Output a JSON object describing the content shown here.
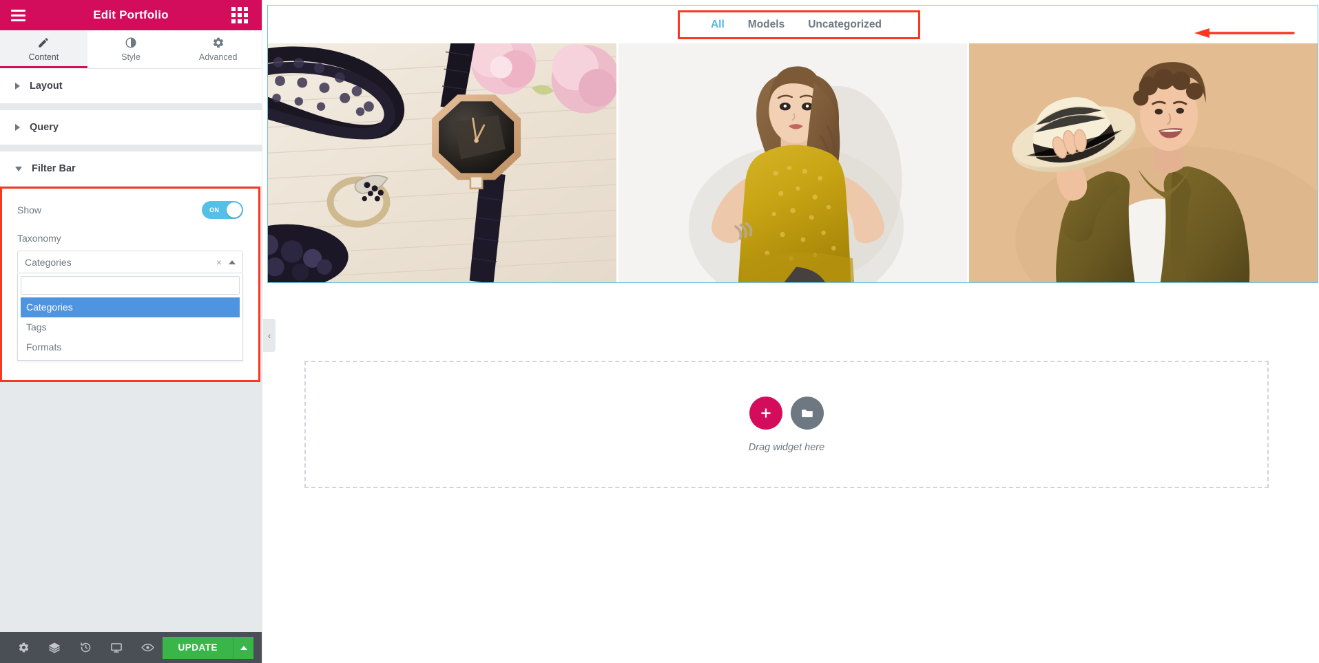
{
  "panel": {
    "header": {
      "title": "Edit Portfolio",
      "menu_icon": "hamburger-icon",
      "apps_icon": "apps-grid-icon"
    },
    "tabs": [
      {
        "label": "Content",
        "icon": "pencil-icon",
        "active": true
      },
      {
        "label": "Style",
        "icon": "contrast-icon",
        "active": false
      },
      {
        "label": "Advanced",
        "icon": "gear-icon",
        "active": false
      }
    ],
    "sections": [
      {
        "label": "Layout",
        "open": false
      },
      {
        "label": "Query",
        "open": false
      },
      {
        "label": "Filter Bar",
        "open": true
      }
    ],
    "filter_bar": {
      "show_label": "Show",
      "show_toggle_state": "ON",
      "taxonomy_label": "Taxonomy",
      "taxonomy_value": "Categories",
      "taxonomy_search_placeholder": "",
      "taxonomy_search_value": "",
      "clear_icon": "×",
      "options": [
        {
          "label": "Categories",
          "highlighted": true
        },
        {
          "label": "Tags",
          "highlighted": false
        },
        {
          "label": "Formats",
          "highlighted": false
        }
      ]
    },
    "footer": {
      "icons": [
        {
          "name": "settings-gear-icon"
        },
        {
          "name": "navigator-layers-icon"
        },
        {
          "name": "history-clock-icon"
        },
        {
          "name": "responsive-monitor-icon"
        },
        {
          "name": "preview-eye-icon"
        }
      ],
      "update_label": "UPDATE",
      "update_caret_icon": "caret-up-icon"
    }
  },
  "canvas": {
    "collapse_handle_icon": "‹",
    "portfolio": {
      "filter_tabs": [
        {
          "label": "All",
          "active": true
        },
        {
          "label": "Models",
          "active": false
        },
        {
          "label": "Uncategorized",
          "active": false
        }
      ],
      "items": [
        {
          "alt": "jewelry-flatlay-watch-ring-necklace"
        },
        {
          "alt": "female-model-gold-sequin-dress"
        },
        {
          "alt": "smiling-man-with-straw-hat"
        }
      ]
    },
    "dropzone": {
      "text": "Drag widget here",
      "add_icon": "plus-icon",
      "template_icon": "folder-icon"
    }
  },
  "colors": {
    "brand_pink": "#d30c5c",
    "annotation_red": "#f93822",
    "accent_blue": "#55b3e8",
    "toggle_on": "#55c0e5",
    "update_green": "#39b54a",
    "widget_outline": "#6ec1e4",
    "option_highlight": "#4f94e0",
    "panel_dark": "#4a4f55"
  }
}
